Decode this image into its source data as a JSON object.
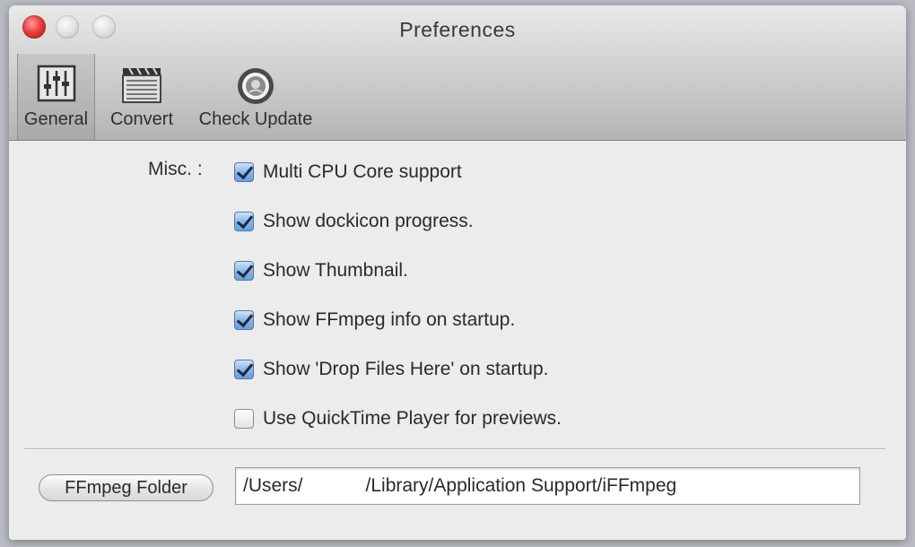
{
  "window": {
    "title": "Preferences",
    "controls": [
      "close",
      "minimize",
      "zoom"
    ]
  },
  "toolbar": {
    "items": [
      {
        "label": "General",
        "icon": "sliders-icon",
        "active": true
      },
      {
        "label": "Convert",
        "icon": "clapperboard-icon",
        "active": false
      },
      {
        "label": "Check Update",
        "icon": "update-badge-icon",
        "active": false
      }
    ]
  },
  "misc": {
    "label": "Misc. :",
    "options": [
      {
        "label": "Multi CPU Core support",
        "checked": true
      },
      {
        "label": "Show dockicon progress.",
        "checked": true
      },
      {
        "label": "Show Thumbnail.",
        "checked": true
      },
      {
        "label": "Show FFmpeg info on startup.",
        "checked": true
      },
      {
        "label": "Show 'Drop Files Here' on startup.",
        "checked": true
      },
      {
        "label": "Use QuickTime Player for previews.",
        "checked": false
      }
    ]
  },
  "ffmpeg": {
    "button_label": "FFmpeg Folder",
    "path_value": "/Users/            /Library/Application Support/iFFmpeg"
  },
  "colors": {
    "checkbox_checked": "#86b3e3",
    "close_button": "#e8403c"
  }
}
